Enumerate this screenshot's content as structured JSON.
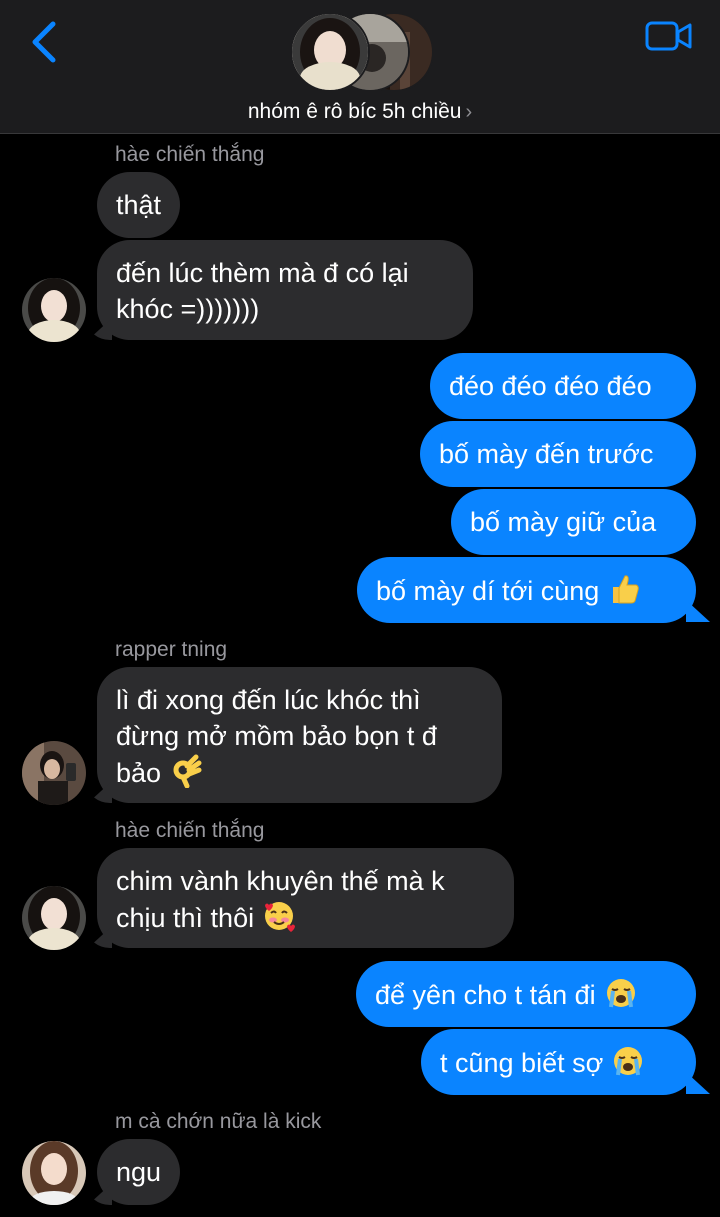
{
  "header": {
    "group_name": "nhóm ê rô bíc 5h chiều",
    "chevron": "›",
    "back_icon": "chevron-left-icon",
    "video_icon": "video-camera-icon",
    "accent": "#0a84ff"
  },
  "messages": [
    {
      "sender": "hàe chiến thắng",
      "direction": "incoming",
      "text": "thật"
    },
    {
      "direction": "incoming",
      "text_lines": [
        "đến lúc thèm mà đ có lại",
        "khóc =)))))))"
      ]
    },
    {
      "direction": "outgoing",
      "text": "đéo đéo đéo đéo"
    },
    {
      "direction": "outgoing",
      "text": "bố mày đến trước"
    },
    {
      "direction": "outgoing",
      "text": "bố mày giữ của"
    },
    {
      "direction": "outgoing",
      "text": "bố mày dí tới cùng",
      "emoji": "thumbs-up-emoji"
    },
    {
      "sender": "rapper tning",
      "direction": "incoming",
      "text_lines": [
        "lì đi xong đến lúc khóc thì",
        "đừng mở mồm bảo bọn t đ",
        "bảo"
      ],
      "emoji": "ok-hand-emoji"
    },
    {
      "sender": "hàe chiến thắng",
      "direction": "incoming",
      "text_lines": [
        "chim vành khuyên thế mà k",
        "chịu thì thôi"
      ],
      "emoji": "smiling-face-with-hearts-emoji"
    },
    {
      "direction": "outgoing",
      "text": "để yên cho t tán đi",
      "emoji": "loudly-crying-emoji"
    },
    {
      "direction": "outgoing",
      "text": "t cũng biết sợ",
      "emoji": "loudly-crying-emoji"
    },
    {
      "sender": "m cà chớn nữa là kick",
      "direction": "incoming",
      "text": "ngu"
    }
  ],
  "colors": {
    "incoming_bubble": "#2c2c2e",
    "outgoing_bubble": "#0a84ff",
    "background": "#000000",
    "header_bg": "#1c1c1e"
  }
}
